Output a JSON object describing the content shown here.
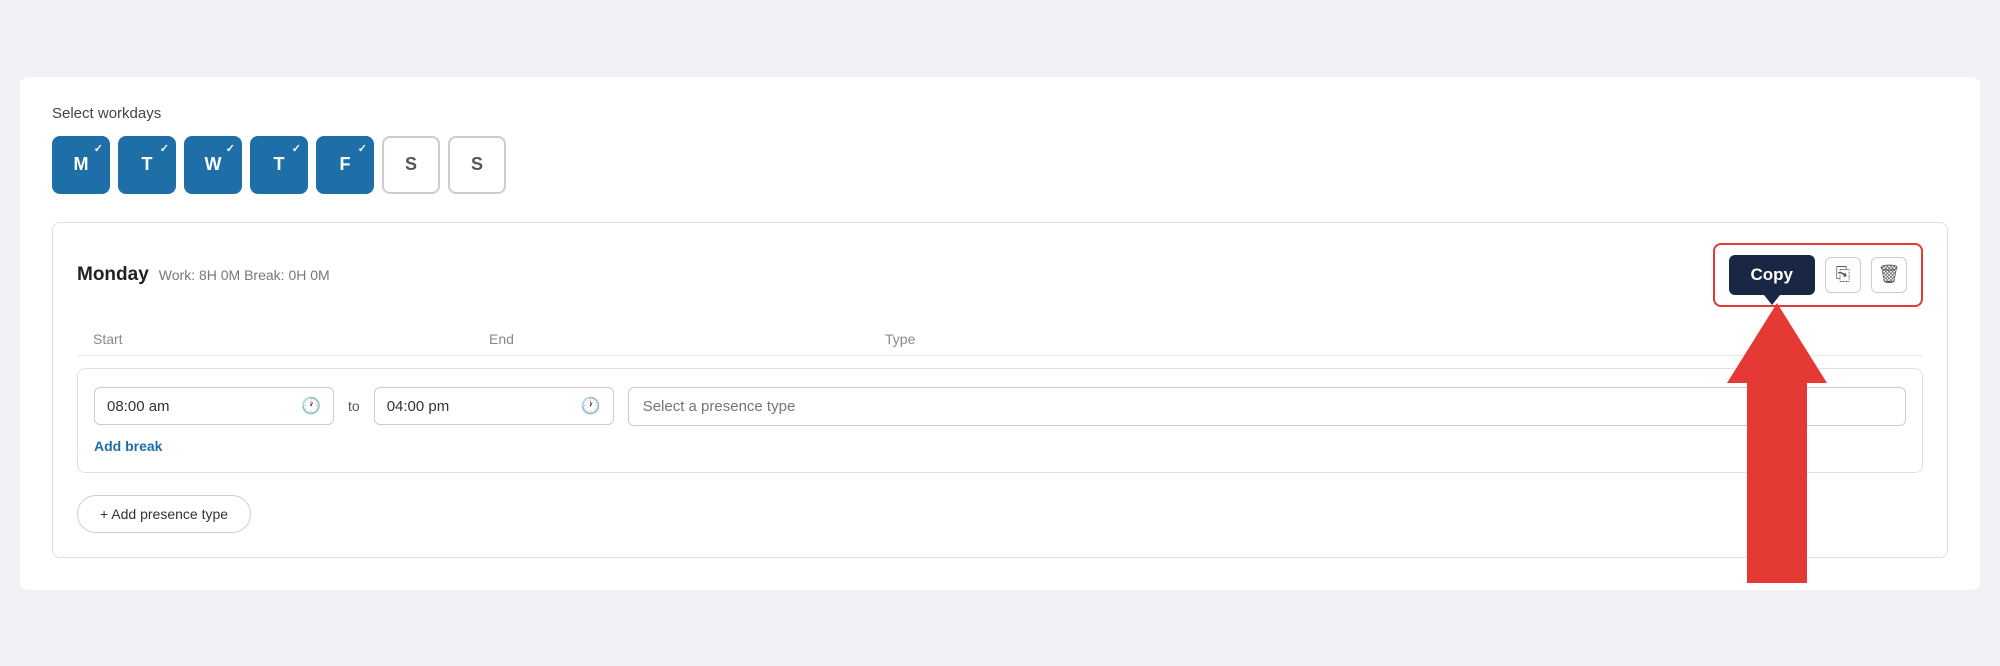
{
  "workdays": {
    "label": "Select workdays",
    "days": [
      {
        "letter": "M",
        "active": true
      },
      {
        "letter": "T",
        "active": true
      },
      {
        "letter": "W",
        "active": true
      },
      {
        "letter": "T",
        "active": true
      },
      {
        "letter": "F",
        "active": true
      },
      {
        "letter": "S",
        "active": false
      },
      {
        "letter": "S",
        "active": false
      }
    ]
  },
  "schedule": {
    "day": "Monday",
    "meta": "Work: 8H 0M  Break: 0H 0M",
    "columns": {
      "start": "Start",
      "end": "End",
      "type": "Type"
    },
    "timeRow": {
      "startTime": "08:00 am",
      "endTime": "04:00 pm",
      "toLabel": "to",
      "presencePlaceholder": "Select a presence type"
    },
    "addBreakLabel": "Add break",
    "addPresenceLabel": "+ Add presence type",
    "copyButton": "Copy",
    "copyTooltip": "Copy"
  }
}
